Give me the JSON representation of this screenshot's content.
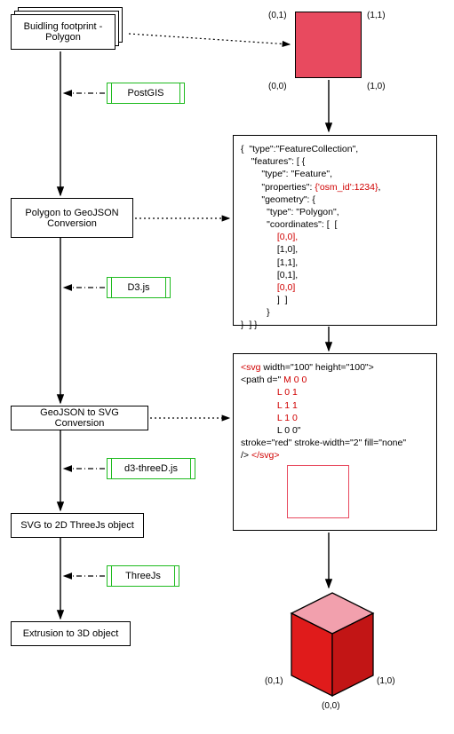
{
  "left": {
    "step1": "Buidling footprint - Polygon",
    "step2": "Polygon to GeoJSON Conversion",
    "step3": "GeoJSON to SVG Conversion",
    "step4": "SVG to 2D ThreeJs object",
    "step5": "Extrusion to 3D object"
  },
  "tools": {
    "t1": "PostGIS",
    "t2": "D3.js",
    "t3": "d3-threeD.js",
    "t4": "ThreeJs"
  },
  "coords": {
    "sq_tl": "(0,1)",
    "sq_tr": "(1,1)",
    "sq_bl": "(0,0)",
    "sq_br": "(1,0)",
    "cube_bl": "(0,1)",
    "cube_br": "(1,0)",
    "cube_bottom": "(0,0)"
  },
  "json_box": {
    "l1": "{  \"type\":\"FeatureCollection\",",
    "l2": "    \"features\": [ {",
    "l3": "        \"type\": \"Feature\",",
    "l4a": "        \"properties\": ",
    "l4b": "{'osm_id':1234}",
    "l4c": ",",
    "l5": "        \"geometry\": {",
    "l6": "          \"type\": \"Polygon\",",
    "l7": "          \"coordinates\": [  [",
    "l8": "              [0,0],",
    "l9": "              [1,0],",
    "l10": "              [1,1],",
    "l11": "              [0,1],",
    "l12": "              [0,0]",
    "l13": "              ]  ]",
    "l14": "          }",
    "l15": "}  ] }"
  },
  "svg_box": {
    "l1a": "<svg ",
    "l1b": "width=\"100\" height=\"100\">",
    "l2a": "<path d=\" ",
    "l2b": "M 0 0",
    "l3": "              L 0 1",
    "l4": "              L 1 1",
    "l5": "              L 1 0",
    "l6": "              L 0 0\"",
    "l7": "stroke=\"red\" stroke-width=\"2\" fill=\"none\"",
    "l8a": "/> ",
    "l8b": "</svg>"
  }
}
